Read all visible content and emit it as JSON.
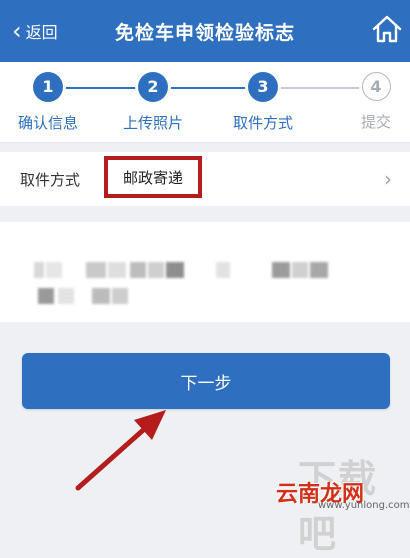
{
  "navbar": {
    "back_label": "返回",
    "title": "免检车申领检验标志"
  },
  "stepper": {
    "steps": [
      {
        "number": "1",
        "label": "确认信息",
        "state": "done"
      },
      {
        "number": "2",
        "label": "上传照片",
        "state": "done"
      },
      {
        "number": "3",
        "label": "取件方式",
        "state": "current"
      },
      {
        "number": "4",
        "label": "提交",
        "state": "pending"
      }
    ]
  },
  "pickup": {
    "label": "取件方式",
    "value": "邮政寄递"
  },
  "actions": {
    "next_label": "下一步"
  },
  "watermark": {
    "site_a": "下载吧",
    "site_b": "云南龙网",
    "site_b_url": "www.yunlong.com"
  },
  "colors": {
    "accent": "#2f6fbf",
    "highlight_box": "#b51c1c",
    "arrow": "#b51c1c"
  },
  "icons": {
    "back": "chevron-left-icon",
    "home": "home-icon",
    "row": "chevron-right-icon"
  }
}
